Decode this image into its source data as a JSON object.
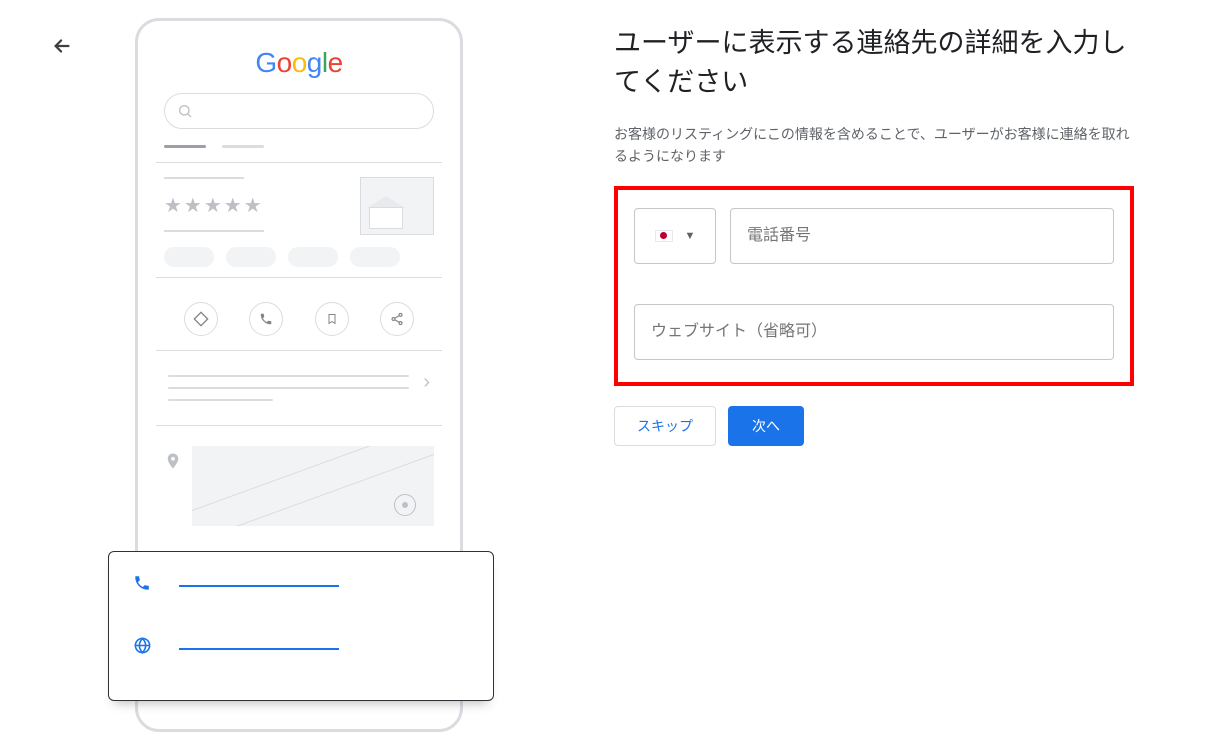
{
  "logo": {
    "char1": "G",
    "char2": "o",
    "char3": "o",
    "char4": "g",
    "char5": "l",
    "char6": "e"
  },
  "preview": {
    "stars": "★★★★★"
  },
  "form": {
    "title": "ユーザーに表示する連絡先の詳細を入力してください",
    "subtitle": "お客様のリスティングにこの情報を含めることで、ユーザーがお客様に連絡を取れるようになります",
    "phone_placeholder": "電話番号",
    "website_placeholder": "ウェブサイト（省略可）",
    "skip_label": "スキップ",
    "next_label": "次へ"
  }
}
